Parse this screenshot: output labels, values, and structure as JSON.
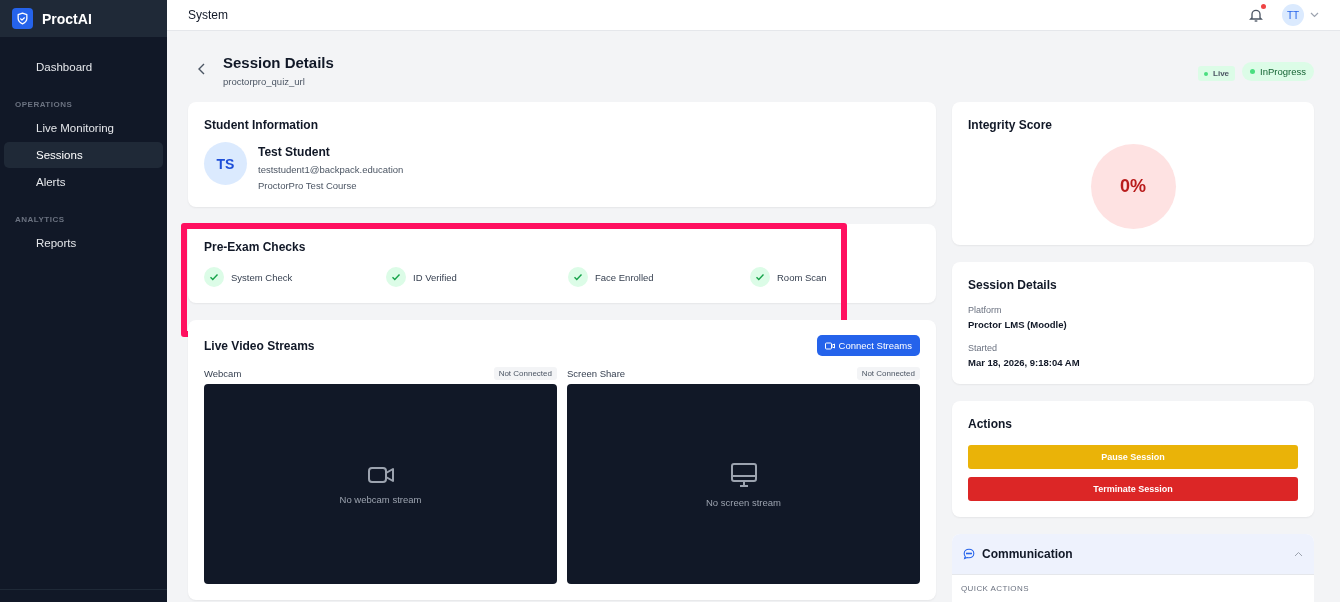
{
  "app": {
    "name": "ProctAI"
  },
  "sidebar": {
    "items": [
      {
        "kind": "link",
        "label": "Dashboard",
        "selected": false
      },
      {
        "kind": "heading",
        "label": "OPERATIONS"
      },
      {
        "kind": "link",
        "label": "Live Monitoring",
        "selected": false
      },
      {
        "kind": "link",
        "label": "Sessions",
        "selected": true
      },
      {
        "kind": "link",
        "label": "Alerts",
        "selected": false
      },
      {
        "kind": "heading",
        "label": "ANALYTICS"
      },
      {
        "kind": "link",
        "label": "Reports",
        "selected": false
      }
    ]
  },
  "header": {
    "title": "System",
    "unread_notifications": true,
    "user_initials": "TT"
  },
  "page": {
    "title": "Session Details",
    "subtitle": "proctorpro_quiz_url",
    "badges": [
      {
        "kind": "small",
        "label": "Live"
      },
      {
        "kind": "large",
        "label": "InProgress"
      }
    ]
  },
  "student": {
    "heading": "Student Information",
    "initials": "TS",
    "name": "Test Student",
    "email": "teststudent1@backpack.education",
    "course": "ProctorPro Test Course"
  },
  "pre_exam_checks": {
    "heading": "Pre-Exam Checks",
    "highlighted": true,
    "items": [
      {
        "label": "System Check",
        "passed": true
      },
      {
        "label": "ID Verified",
        "passed": true
      },
      {
        "label": "Face Enrolled",
        "passed": true
      },
      {
        "label": "Room Scan",
        "passed": true
      }
    ]
  },
  "video": {
    "heading": "Live Video Streams",
    "button": "Connect Streams",
    "streams": [
      {
        "kind": "webcam",
        "label": "Webcam",
        "status": "Not Connected",
        "empty_text": "No webcam stream"
      },
      {
        "kind": "screen",
        "label": "Screen Share",
        "status": "Not Connected",
        "empty_text": "No screen stream"
      }
    ]
  },
  "integrity": {
    "heading": "Integrity Score",
    "score": "0%"
  },
  "session_details": {
    "heading": "Session Details",
    "fields": [
      {
        "label": "Platform",
        "value": "Proctor LMS (Moodle)"
      },
      {
        "label": "Started",
        "value": "Mar 18, 2026, 9:18:04 AM"
      }
    ]
  },
  "actions": {
    "heading": "Actions",
    "buttons": [
      {
        "kind": "warning",
        "label": "Pause Session"
      },
      {
        "kind": "danger",
        "label": "Terminate Session"
      }
    ]
  },
  "communication": {
    "heading": "Communication",
    "expanded": true,
    "section_label": "QUICK ACTIONS"
  }
}
